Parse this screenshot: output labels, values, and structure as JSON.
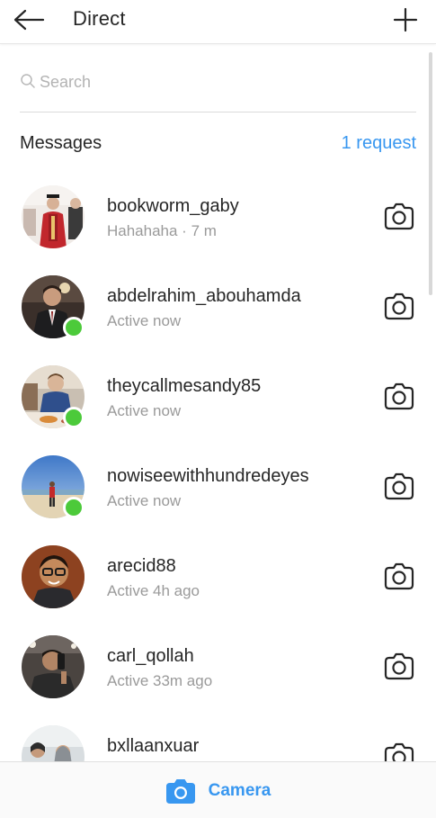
{
  "header": {
    "title": "Direct",
    "back_icon": "arrow-left-icon",
    "new_icon": "plus-icon"
  },
  "search": {
    "placeholder": "Search",
    "value": "",
    "icon": "search-icon"
  },
  "section": {
    "title": "Messages",
    "requests_label": "1 request"
  },
  "conversations": [
    {
      "username": "bookworm_gaby",
      "status": "Hahahaha · 7 m",
      "online": false,
      "avatar_icon": "avatar-graduation"
    },
    {
      "username": "abdelrahim_abouhamda",
      "status": "Active now",
      "online": true,
      "avatar_icon": "avatar-suit"
    },
    {
      "username": "theycallmesandy85",
      "status": "Active now",
      "online": true,
      "avatar_icon": "avatar-dining"
    },
    {
      "username": "nowiseewithhundredeyes",
      "status": "Active now",
      "online": true,
      "avatar_icon": "avatar-beach"
    },
    {
      "username": "arecid88",
      "status": "Active 4h ago",
      "online": false,
      "avatar_icon": "avatar-glasses"
    },
    {
      "username": "carl_qollah",
      "status": "Active 33m ago",
      "online": false,
      "avatar_icon": "avatar-selfie"
    },
    {
      "username": "bxllaanxuar",
      "status": "",
      "online": false,
      "avatar_icon": "avatar-group"
    }
  ],
  "bottom_bar": {
    "label": "Camera",
    "icon": "camera-icon"
  },
  "colors": {
    "accent": "#3897f0",
    "online": "#4cca3a",
    "text": "#262626",
    "muted": "#9a9a9a"
  }
}
